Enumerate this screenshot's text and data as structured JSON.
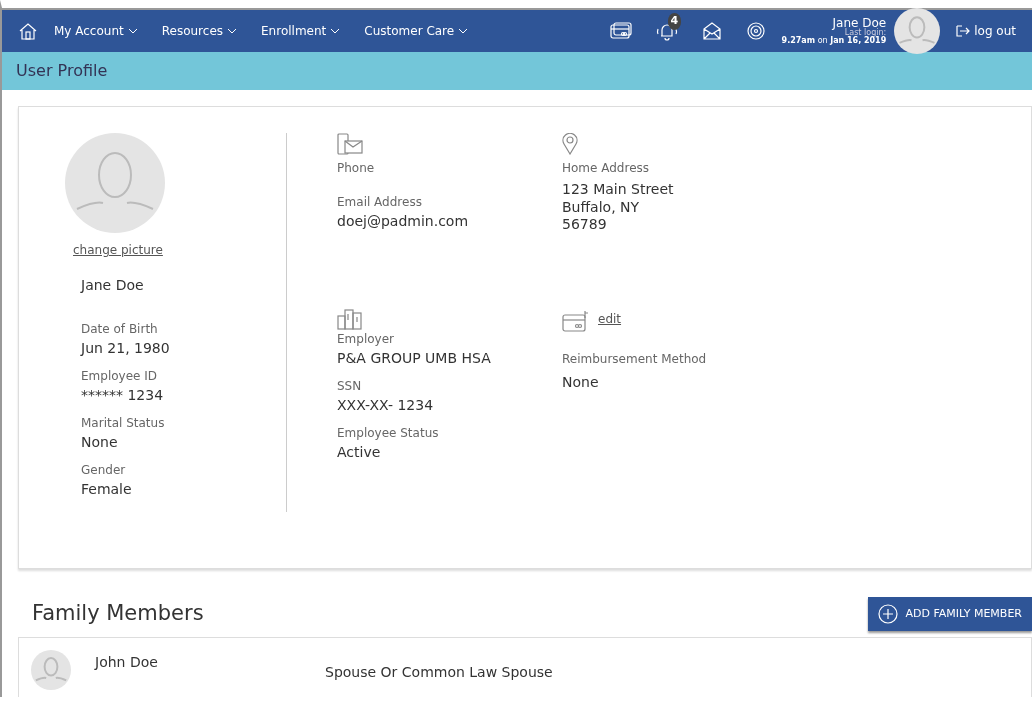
{
  "nav": {
    "menu": [
      "My Account",
      "Resources",
      "Enrollment",
      "Customer Care"
    ],
    "notification_count": "4",
    "user_name": "Jane Doe",
    "last_login_label": "Last login:",
    "last_login_time": "**9.27am** on **Jan 16, 2019**",
    "logout": "log out"
  },
  "page_title": "User Profile",
  "profile": {
    "change_picture": "change picture",
    "name": "Jane Doe",
    "details": [
      {
        "label": "Date of Birth",
        "value": "Jun 21, 1980"
      },
      {
        "label": "Employee ID",
        "value": "****** 1234"
      },
      {
        "label": "Marital Status",
        "value": "None"
      },
      {
        "label": "Gender",
        "value": "Female"
      }
    ]
  },
  "contact": {
    "phone_label": "Phone",
    "email_label": "Email Address",
    "email": "doej@padmin.com",
    "address_label": "Home Address",
    "address_lines": [
      "123 Main Street",
      "Buffalo, NY",
      "56789"
    ]
  },
  "employment": [
    {
      "label": "Employer",
      "value": "P&A GROUP UMB HSA"
    },
    {
      "label": "SSN",
      "value": "XXX-XX- 1234"
    },
    {
      "label": "Employee Status",
      "value": "Active"
    }
  ],
  "reimbursement": {
    "edit": "edit",
    "label": "Reimbursement Method",
    "value": "None"
  },
  "family": {
    "title": "Family Members",
    "add_button": "ADD FAMILY MEMBER",
    "members": [
      {
        "name": "John Doe",
        "relation": "Spouse Or Common Law Spouse"
      }
    ]
  }
}
